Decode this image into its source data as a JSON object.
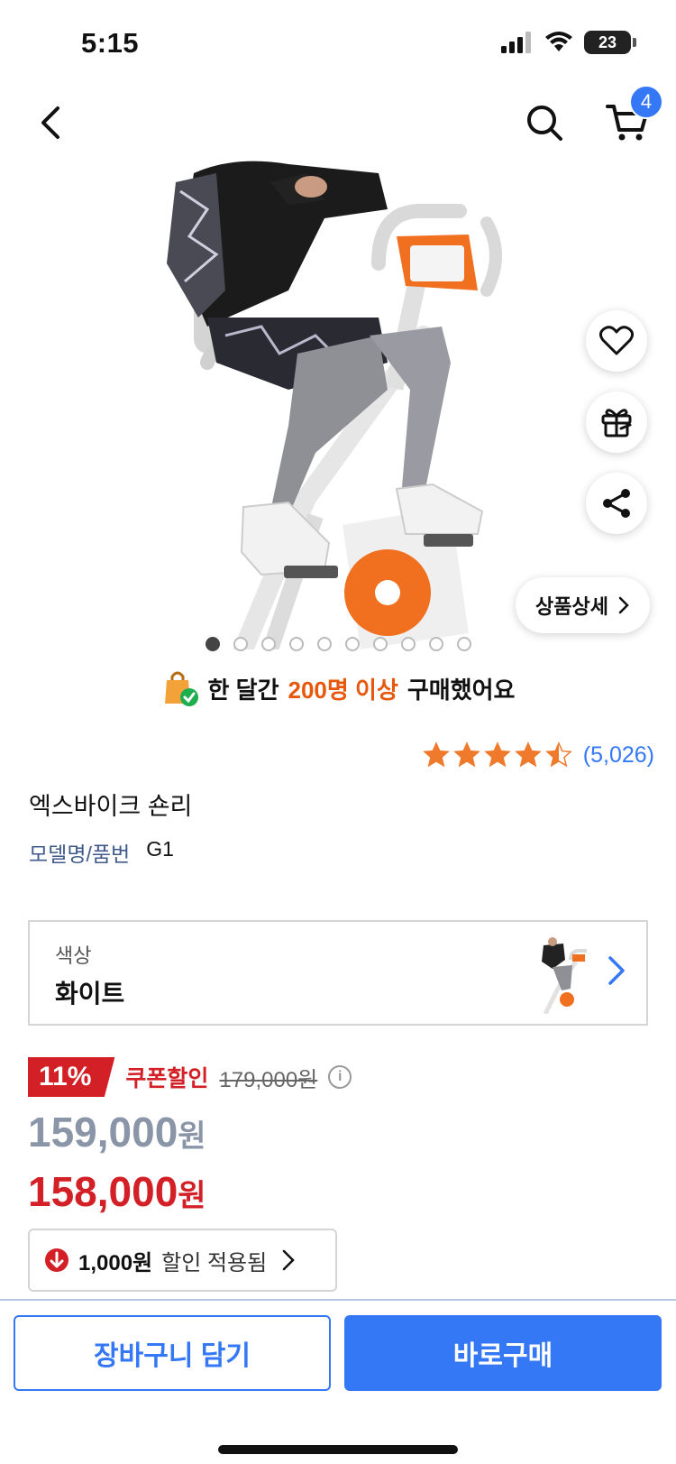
{
  "status_bar": {
    "time": "5:15",
    "battery": "23"
  },
  "nav": {
    "cart_count": "4"
  },
  "hero": {
    "detail_button": "상품상세"
  },
  "purchase_notice": {
    "prefix": "한 달간",
    "highlight": "200명 이상",
    "suffix": "구매했어요"
  },
  "rating": {
    "stars": 4.5,
    "count": "(5,026)"
  },
  "product": {
    "name": "엑스바이크 숀리",
    "model_label": "모델명/품번",
    "model_value": "G1"
  },
  "option": {
    "label": "색상",
    "value": "화이트"
  },
  "price": {
    "discount_rate": "11%",
    "coupon_label": "쿠폰할인",
    "original": "179,000원",
    "list_amount": "159,000",
    "final_amount": "158,000",
    "won": "원"
  },
  "coupon_chip": {
    "amount": "1,000원",
    "text": "할인 적용됨"
  },
  "bottom": {
    "cart_button": "장바구니 담기",
    "buy_button": "바로구매"
  },
  "colors": {
    "accent_blue": "#3478f6",
    "sale_red": "#d31f26",
    "highlight_orange": "#e8580c"
  }
}
